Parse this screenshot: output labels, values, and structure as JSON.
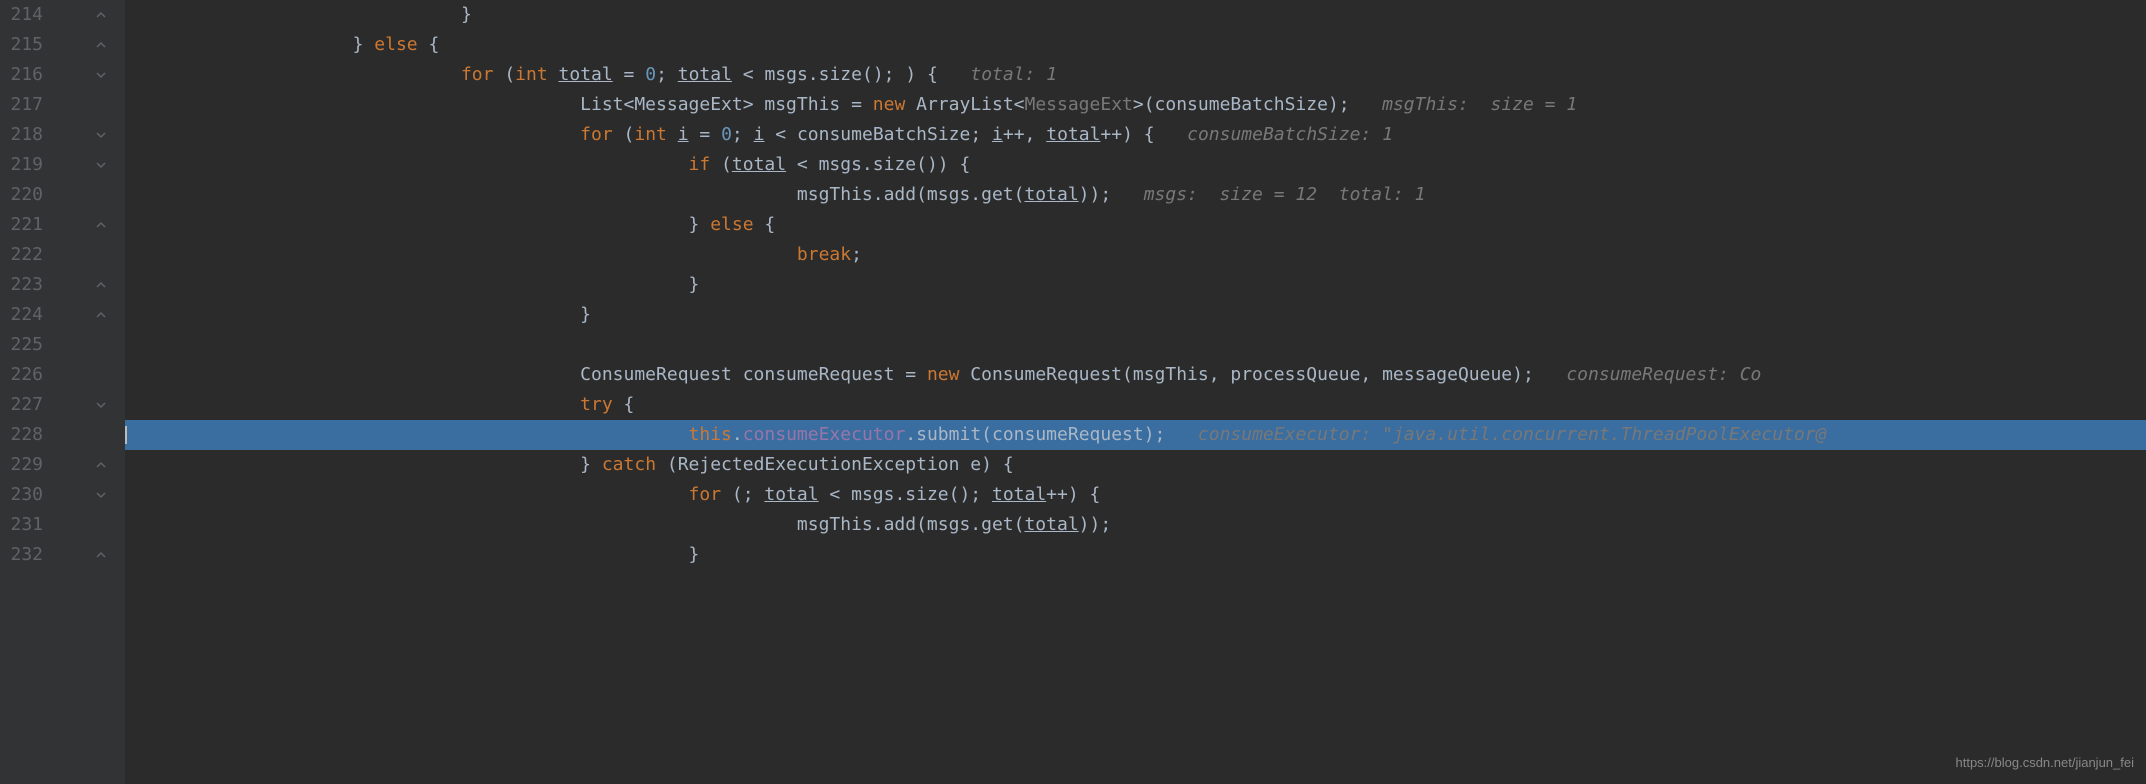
{
  "watermark": "https://blog.csdn.net/jianjun_fei",
  "lines": [
    {
      "num": "214",
      "fold": "close",
      "indent": 12,
      "tokens": [
        {
          "t": "plain",
          "v": "}"
        }
      ]
    },
    {
      "num": "215",
      "fold": "close",
      "indent": 8,
      "tokens": [
        {
          "t": "plain",
          "v": "} "
        },
        {
          "t": "kw",
          "v": "else "
        },
        {
          "t": "plain",
          "v": "{"
        }
      ]
    },
    {
      "num": "216",
      "fold": "open",
      "indent": 12,
      "tokens": [
        {
          "t": "kw",
          "v": "for "
        },
        {
          "t": "plain",
          "v": "("
        },
        {
          "t": "kw",
          "v": "int "
        },
        {
          "t": "param",
          "v": "total"
        },
        {
          "t": "plain",
          "v": " = "
        },
        {
          "t": "num",
          "v": "0"
        },
        {
          "t": "plain",
          "v": "; "
        },
        {
          "t": "param",
          "v": "total"
        },
        {
          "t": "plain",
          "v": " < msgs.size(); ) {   "
        },
        {
          "t": "hint",
          "v": "total: 1"
        }
      ]
    },
    {
      "num": "217",
      "fold": "",
      "indent": 16,
      "tokens": [
        {
          "t": "plain",
          "v": "List<MessageExt> msgThis = "
        },
        {
          "t": "kw",
          "v": "new "
        },
        {
          "t": "plain",
          "v": "ArrayList<"
        },
        {
          "t": "type-hint",
          "v": "MessageExt"
        },
        {
          "t": "plain",
          "v": ">(consumeBatchSize);   "
        },
        {
          "t": "hint",
          "v": "msgThis:  size = 1"
        }
      ]
    },
    {
      "num": "218",
      "fold": "open",
      "indent": 16,
      "tokens": [
        {
          "t": "kw",
          "v": "for "
        },
        {
          "t": "plain",
          "v": "("
        },
        {
          "t": "kw",
          "v": "int "
        },
        {
          "t": "param",
          "v": "i"
        },
        {
          "t": "plain",
          "v": " = "
        },
        {
          "t": "num",
          "v": "0"
        },
        {
          "t": "plain",
          "v": "; "
        },
        {
          "t": "param",
          "v": "i"
        },
        {
          "t": "plain",
          "v": " < consumeBatchSize; "
        },
        {
          "t": "param",
          "v": "i"
        },
        {
          "t": "plain",
          "v": "++, "
        },
        {
          "t": "param",
          "v": "total"
        },
        {
          "t": "plain",
          "v": "++) {   "
        },
        {
          "t": "hint",
          "v": "consumeBatchSize: 1"
        }
      ]
    },
    {
      "num": "219",
      "fold": "open",
      "indent": 20,
      "tokens": [
        {
          "t": "kw",
          "v": "if "
        },
        {
          "t": "plain",
          "v": "("
        },
        {
          "t": "param",
          "v": "total"
        },
        {
          "t": "plain",
          "v": " < msgs.size()) {"
        }
      ]
    },
    {
      "num": "220",
      "fold": "",
      "indent": 24,
      "tokens": [
        {
          "t": "plain",
          "v": "msgThis.add(msgs.get("
        },
        {
          "t": "param",
          "v": "total"
        },
        {
          "t": "plain",
          "v": "));   "
        },
        {
          "t": "hint",
          "v": "msgs:  size = 12  total: 1"
        }
      ]
    },
    {
      "num": "221",
      "fold": "close",
      "indent": 20,
      "tokens": [
        {
          "t": "plain",
          "v": "} "
        },
        {
          "t": "kw",
          "v": "else "
        },
        {
          "t": "plain",
          "v": "{"
        }
      ]
    },
    {
      "num": "222",
      "fold": "",
      "indent": 24,
      "tokens": [
        {
          "t": "kw",
          "v": "break"
        },
        {
          "t": "plain",
          "v": ";"
        }
      ]
    },
    {
      "num": "223",
      "fold": "close",
      "indent": 20,
      "tokens": [
        {
          "t": "plain",
          "v": "}"
        }
      ]
    },
    {
      "num": "224",
      "fold": "close",
      "indent": 16,
      "tokens": [
        {
          "t": "plain",
          "v": "}"
        }
      ]
    },
    {
      "num": "225",
      "fold": "",
      "indent": 0,
      "tokens": []
    },
    {
      "num": "226",
      "fold": "",
      "indent": 16,
      "tokens": [
        {
          "t": "plain",
          "v": "ConsumeRequest consumeRequest = "
        },
        {
          "t": "kw",
          "v": "new "
        },
        {
          "t": "plain",
          "v": "ConsumeRequest(msgThis, processQueue, messageQueue);   "
        },
        {
          "t": "hint",
          "v": "consumeRequest: Co"
        }
      ]
    },
    {
      "num": "227",
      "fold": "open",
      "indent": 16,
      "tokens": [
        {
          "t": "kw",
          "v": "try "
        },
        {
          "t": "plain",
          "v": "{"
        }
      ]
    },
    {
      "num": "228",
      "fold": "",
      "indent": 20,
      "highlighted": true,
      "cursor": true,
      "tokens": [
        {
          "t": "kw",
          "v": "this"
        },
        {
          "t": "plain",
          "v": "."
        },
        {
          "t": "field",
          "v": "consumeExecutor"
        },
        {
          "t": "plain",
          "v": ".submit(consumeRequest);   "
        },
        {
          "t": "hint",
          "v": "consumeExecutor: \"java.util.concurrent.ThreadPoolExecutor@"
        }
      ]
    },
    {
      "num": "229",
      "fold": "close",
      "indent": 16,
      "tokens": [
        {
          "t": "plain",
          "v": "} "
        },
        {
          "t": "kw",
          "v": "catch "
        },
        {
          "t": "plain",
          "v": "(RejectedExecutionException e) {"
        }
      ]
    },
    {
      "num": "230",
      "fold": "open",
      "indent": 20,
      "tokens": [
        {
          "t": "kw",
          "v": "for "
        },
        {
          "t": "plain",
          "v": "(; "
        },
        {
          "t": "param",
          "v": "total"
        },
        {
          "t": "plain",
          "v": " < msgs.size(); "
        },
        {
          "t": "param",
          "v": "total"
        },
        {
          "t": "plain",
          "v": "++) {"
        }
      ]
    },
    {
      "num": "231",
      "fold": "",
      "indent": 24,
      "tokens": [
        {
          "t": "plain",
          "v": "msgThis.add(msgs.get("
        },
        {
          "t": "param",
          "v": "total"
        },
        {
          "t": "plain",
          "v": "));"
        }
      ]
    },
    {
      "num": "232",
      "fold": "close",
      "indent": 20,
      "tokens": [
        {
          "t": "plain",
          "v": "}"
        }
      ]
    }
  ]
}
